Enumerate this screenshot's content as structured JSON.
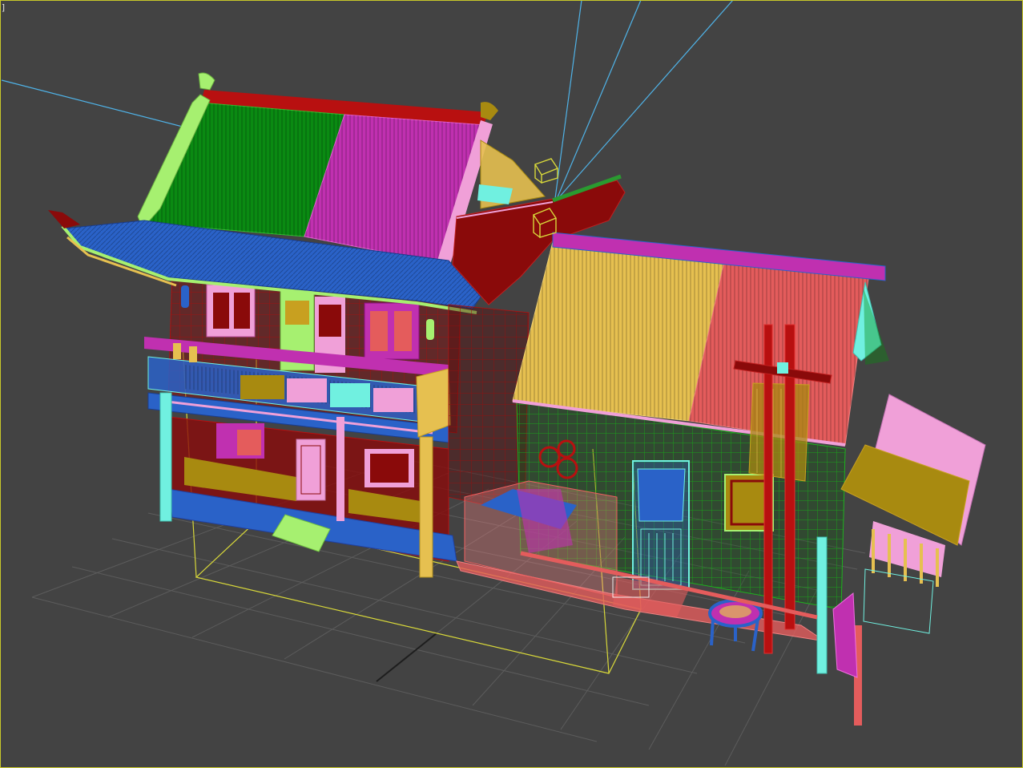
{
  "viewport": {
    "label": "]",
    "colors": {
      "background": "#434343",
      "border_active": "#c8c82a",
      "grid": "#5c5c5c",
      "grid_axis": "#1e1e1e",
      "light_line": "#4fb3e8",
      "selection_box": "#d8d83a"
    }
  },
  "scene": {
    "objects": [
      "grid-floor",
      "left-building-roof",
      "right-building-roof",
      "balcony",
      "doors",
      "windows",
      "lanterns",
      "cross-pole",
      "awning",
      "stool",
      "lights",
      "selection-box"
    ],
    "palette": {
      "green": "#0a8a12",
      "magenta": "#c030b0",
      "blue": "#2a62c8",
      "lime": "#a6f070",
      "red": "#8a0a0a",
      "yellow": "#e6c050",
      "salmon": "#e45c5c",
      "pink": "#f0a0d8",
      "cyan": "#70f0e0",
      "olive": "#a88a10",
      "bright_green": "#22c022"
    }
  }
}
